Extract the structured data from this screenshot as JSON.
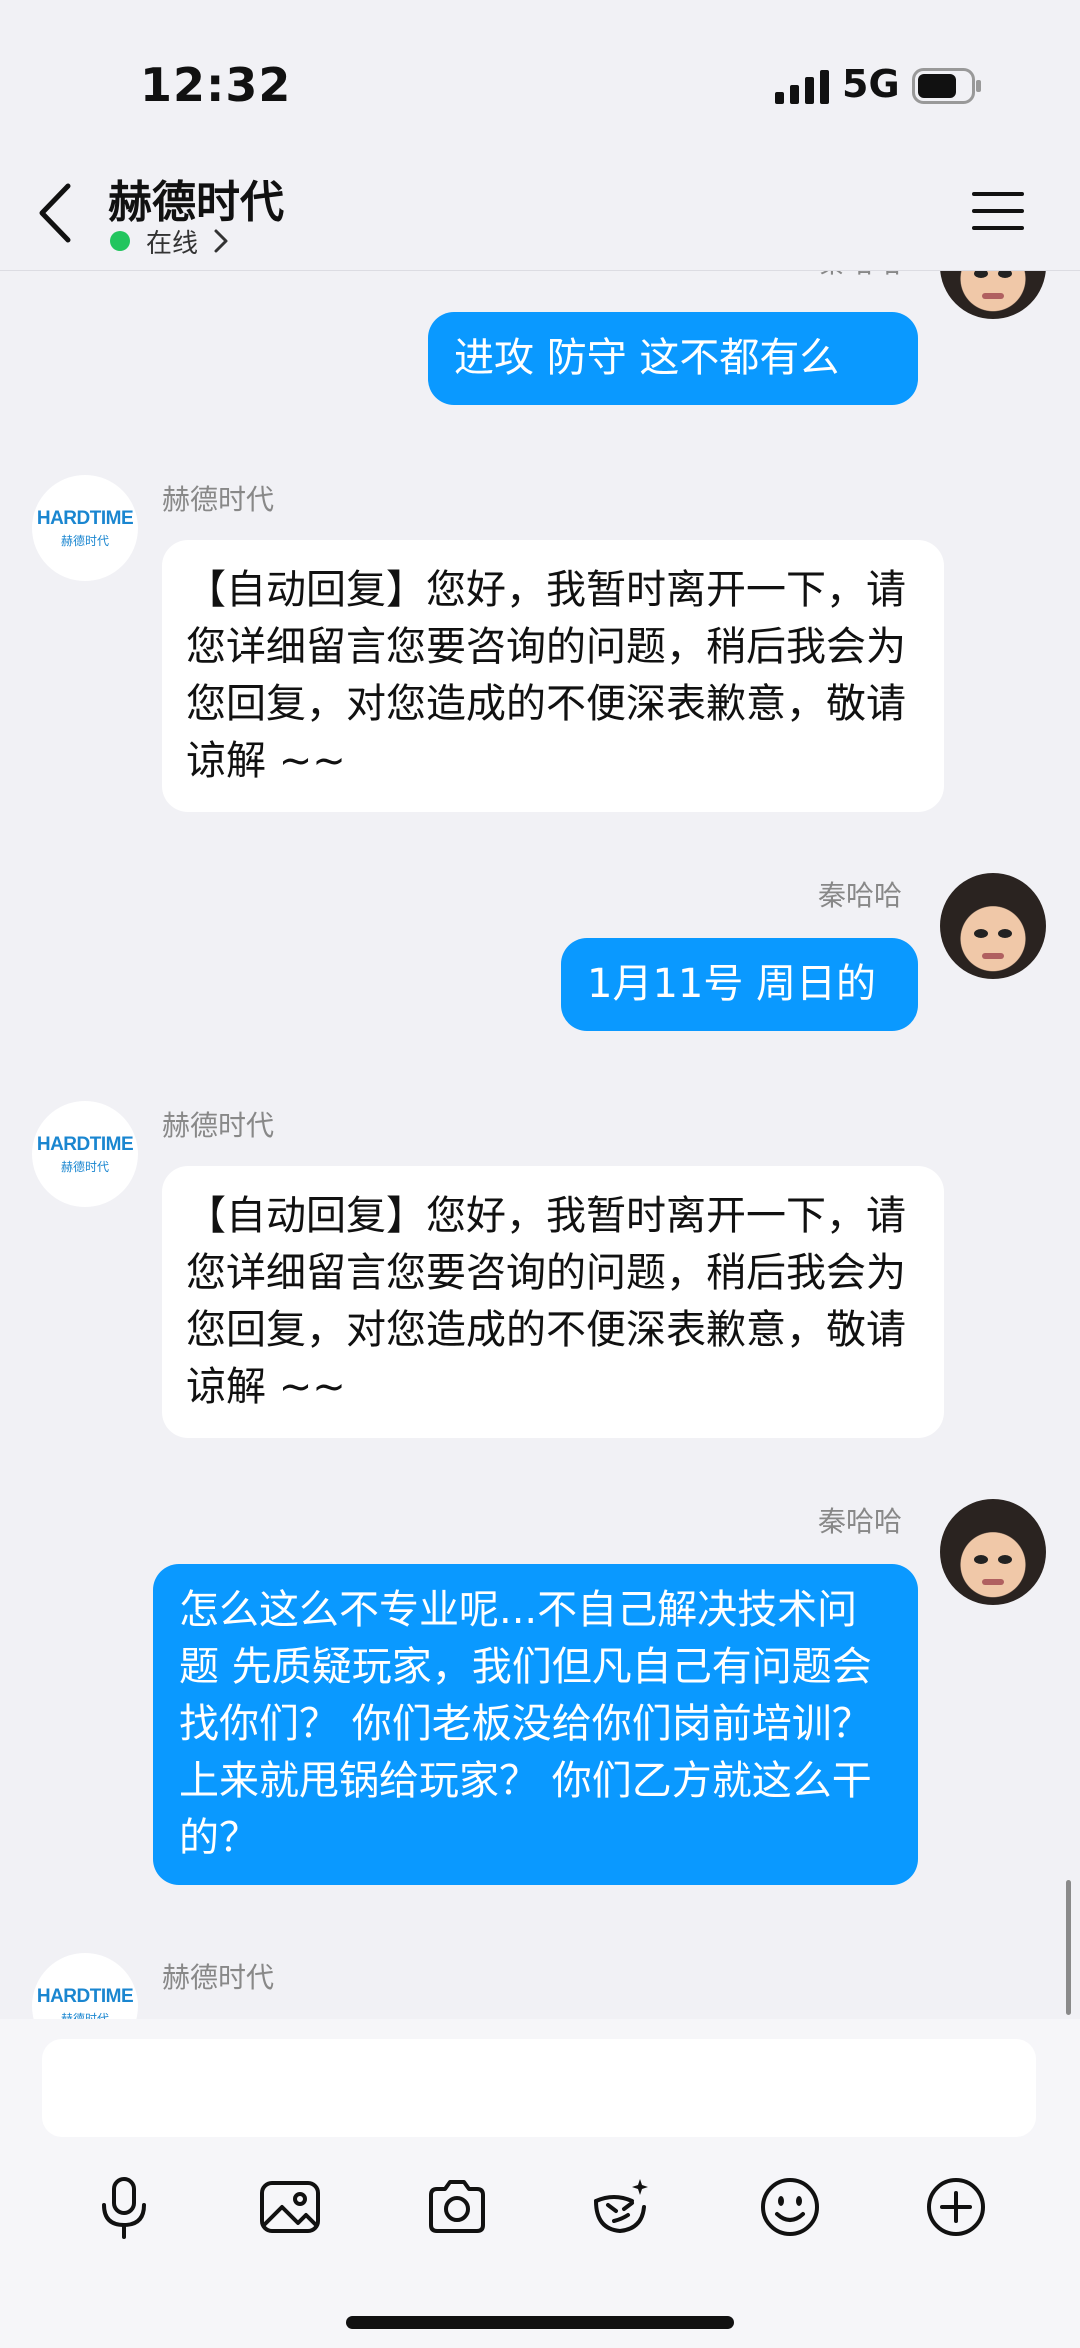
{
  "status_bar": {
    "time": "12:32",
    "network": "5G"
  },
  "header": {
    "title": "赫德时代",
    "status": "在线"
  },
  "messages": [
    {
      "from": "me",
      "sender": "秦哈哈",
      "text": "进攻 防守 这不都有么"
    },
    {
      "from": "other",
      "sender": "赫德时代",
      "text": "【自动回复】您好，我暂时离开一下，请您详细留言您要咨询的问题，稍后我会为您回复，对您造成的不便深表歉意，敬请谅解 ~~"
    },
    {
      "from": "me",
      "sender": "秦哈哈",
      "text": "1月11号 周日的"
    },
    {
      "from": "other",
      "sender": "赫德时代",
      "text": "【自动回复】您好，我暂时离开一下，请您详细留言您要咨询的问题，稍后我会为您回复，对您造成的不便深表歉意，敬请谅解 ~~"
    },
    {
      "from": "me",
      "sender": "秦哈哈",
      "text": "怎么这么不专业呢...不自己解决技术问题 先质疑玩家，我们但凡自己有问题会找你们？ 你们老板没给你们岗前培训？上来就甩锅给玩家？ 你们乙方就这么干的？"
    },
    {
      "from": "other",
      "sender": "赫德时代",
      "text": ""
    }
  ],
  "logo": {
    "text_en": "HARDTIME",
    "text_cn": "赫德时代"
  },
  "input": {
    "placeholder": ""
  },
  "toolbar": [
    "microphone-icon",
    "image-icon",
    "camera-icon",
    "sticker-icon",
    "emoji-icon",
    "plus-icon"
  ],
  "colors": {
    "my_bubble": "#0a99ff",
    "online_dot": "#22c55e",
    "logo_blue": "#1a86d0",
    "background": "#f1f1f5"
  }
}
